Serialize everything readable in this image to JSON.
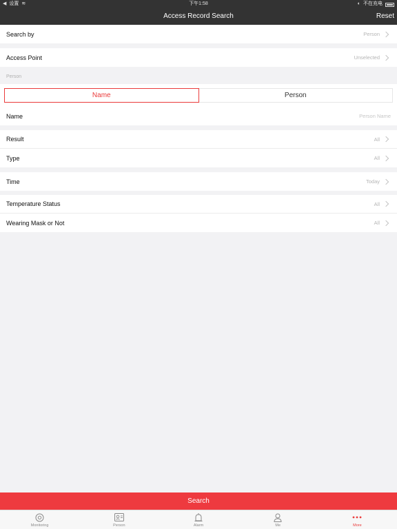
{
  "status_bar": {
    "carrier": "设置",
    "time": "下午1:58",
    "charging": "不在充电"
  },
  "nav": {
    "title": "Access Record Search",
    "reset_label": "Reset"
  },
  "search_by": {
    "label": "Search by",
    "value": "Person"
  },
  "access_point": {
    "label": "Access Point",
    "value": "Unselected"
  },
  "person_section": {
    "caption": "Person",
    "segments": [
      "Name",
      "Person"
    ],
    "selected_segment": "Name"
  },
  "name_field": {
    "label": "Name",
    "placeholder": "Person Name"
  },
  "result": {
    "label": "Result",
    "value": "All"
  },
  "type": {
    "label": "Type",
    "value": "All"
  },
  "time": {
    "label": "Time",
    "value": "Today"
  },
  "temperature_status": {
    "label": "Temperature Status",
    "value": "All"
  },
  "wearing_mask": {
    "label": "Wearing Mask or Not",
    "value": "All"
  },
  "search_button": {
    "label": "Search"
  },
  "tabbar": {
    "items": [
      {
        "label": "Monitoring",
        "icon": "monitoring-icon"
      },
      {
        "label": "Person",
        "icon": "person-card-icon"
      },
      {
        "label": "Alarm",
        "icon": "alarm-icon"
      },
      {
        "label": "Me",
        "icon": "user-icon"
      },
      {
        "label": "More",
        "icon": "more-icon"
      }
    ],
    "active_index": 4
  },
  "colors": {
    "accent": "#ee3a3f",
    "navbar": "#333333",
    "background": "#f2f2f4"
  }
}
